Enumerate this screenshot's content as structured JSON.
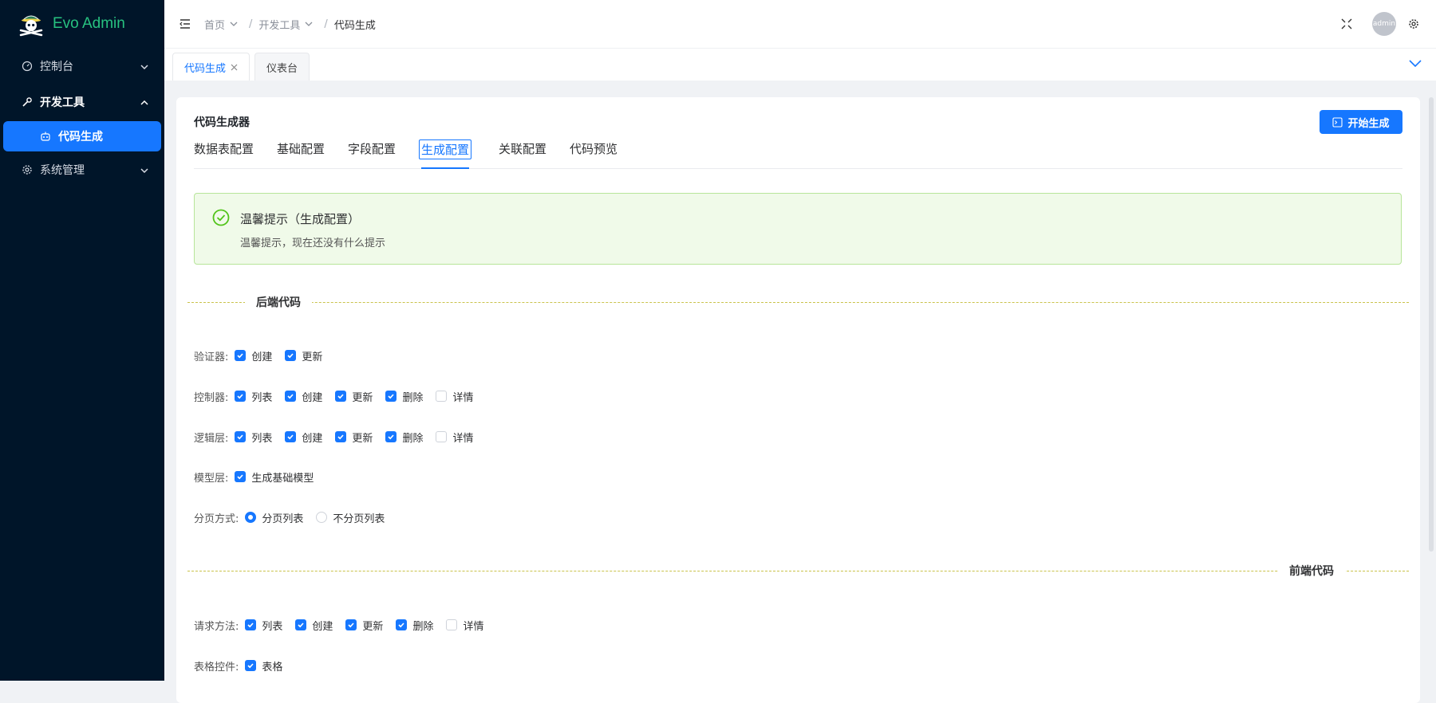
{
  "app": {
    "name": "Evo Admin"
  },
  "sidebar": {
    "items": [
      {
        "label": "控制台",
        "icon": "dashboard-icon",
        "expanded": false
      },
      {
        "label": "开发工具",
        "icon": "wrench-icon",
        "expanded": true,
        "children": [
          {
            "label": "代码生成",
            "icon": "robot-icon",
            "active": true
          }
        ]
      },
      {
        "label": "系统管理",
        "icon": "gear-icon",
        "expanded": false
      }
    ]
  },
  "header": {
    "breadcrumb": [
      "首页",
      "开发工具",
      "代码生成"
    ],
    "avatar_text": "admin"
  },
  "page_tabs": [
    {
      "label": "代码生成",
      "active": true,
      "closable": true
    },
    {
      "label": "仪表台",
      "active": false,
      "closable": false
    }
  ],
  "card": {
    "title": "代码生成器",
    "generate_button": "开始生成",
    "tabs": [
      "数据表配置",
      "基础配置",
      "字段配置",
      "生成配置",
      "关联配置",
      "代码预览"
    ],
    "active_tab": "生成配置"
  },
  "alert": {
    "title": "温馨提示（生成配置）",
    "description": "温馨提示，现在还没有什么提示"
  },
  "backend": {
    "section_label": "后端代码",
    "validator": {
      "label": "验证器:",
      "options": [
        {
          "label": "创建",
          "checked": true
        },
        {
          "label": "更新",
          "checked": true
        }
      ]
    },
    "controller": {
      "label": "控制器:",
      "options": [
        {
          "label": "列表",
          "checked": true
        },
        {
          "label": "创建",
          "checked": true
        },
        {
          "label": "更新",
          "checked": true
        },
        {
          "label": "删除",
          "checked": true
        },
        {
          "label": "详情",
          "checked": false
        }
      ]
    },
    "logic": {
      "label": "逻辑层:",
      "options": [
        {
          "label": "列表",
          "checked": true
        },
        {
          "label": "创建",
          "checked": true
        },
        {
          "label": "更新",
          "checked": true
        },
        {
          "label": "删除",
          "checked": true
        },
        {
          "label": "详情",
          "checked": false
        }
      ]
    },
    "model": {
      "label": "模型层:",
      "options": [
        {
          "label": "生成基础模型",
          "checked": true
        }
      ]
    },
    "pagination": {
      "label": "分页方式:",
      "options": [
        {
          "label": "分页列表",
          "selected": true
        },
        {
          "label": "不分页列表",
          "selected": false
        }
      ]
    }
  },
  "frontend": {
    "section_label": "前端代码",
    "request": {
      "label": "请求方法:",
      "options": [
        {
          "label": "列表",
          "checked": true
        },
        {
          "label": "创建",
          "checked": true
        },
        {
          "label": "更新",
          "checked": true
        },
        {
          "label": "删除",
          "checked": true
        },
        {
          "label": "详情",
          "checked": false
        }
      ]
    },
    "table": {
      "label": "表格控件:",
      "options": [
        {
          "label": "表格",
          "checked": true
        }
      ]
    }
  },
  "colors": {
    "primary": "#1677ff",
    "sidebar_bg": "#001529",
    "brand_green": "#27c280",
    "success_bg": "#f0fae9"
  }
}
